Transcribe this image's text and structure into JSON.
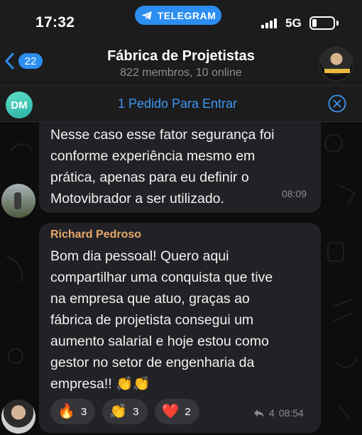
{
  "status_bar": {
    "time": "17:32",
    "app_pill": "TELEGRAM",
    "network": "5G",
    "battery_level": 0.2
  },
  "header": {
    "back_count": "22",
    "title": "Fábrica de Projetistas",
    "subtitle": "822 membros, 10 online"
  },
  "join_bar": {
    "avatar_initials": "DM",
    "text": "1 Pedido Para Entrar"
  },
  "messages": [
    {
      "text": "Nesse caso esse fator segurança foi\nconforme experiência mesmo em\nprática, apenas para eu definir o\nMotovibrador a ser utilizado.",
      "time": "08:09"
    },
    {
      "sender": "Richard Pedroso",
      "text": "Bom dia pessoal! Quero aqui\ncompartilhar uma conquista que tive\nna empresa que atuo, graças ao\nfábrica de projetista consegui um\naumento salarial e hoje estou como\ngestor no setor de engenharia da\nempresa!! 👏👏",
      "reactions": [
        {
          "emoji": "🔥",
          "count": "3"
        },
        {
          "emoji": "👏",
          "count": "3"
        },
        {
          "emoji": "❤️",
          "count": "2"
        }
      ],
      "replies": "4",
      "time": "08:54"
    }
  ],
  "colors": {
    "accent": "#2c8ef0",
    "link": "#3c97f0",
    "sender_name": "#e8a86a",
    "bubble": "#222226",
    "header_bg": "#1c1c1d"
  }
}
